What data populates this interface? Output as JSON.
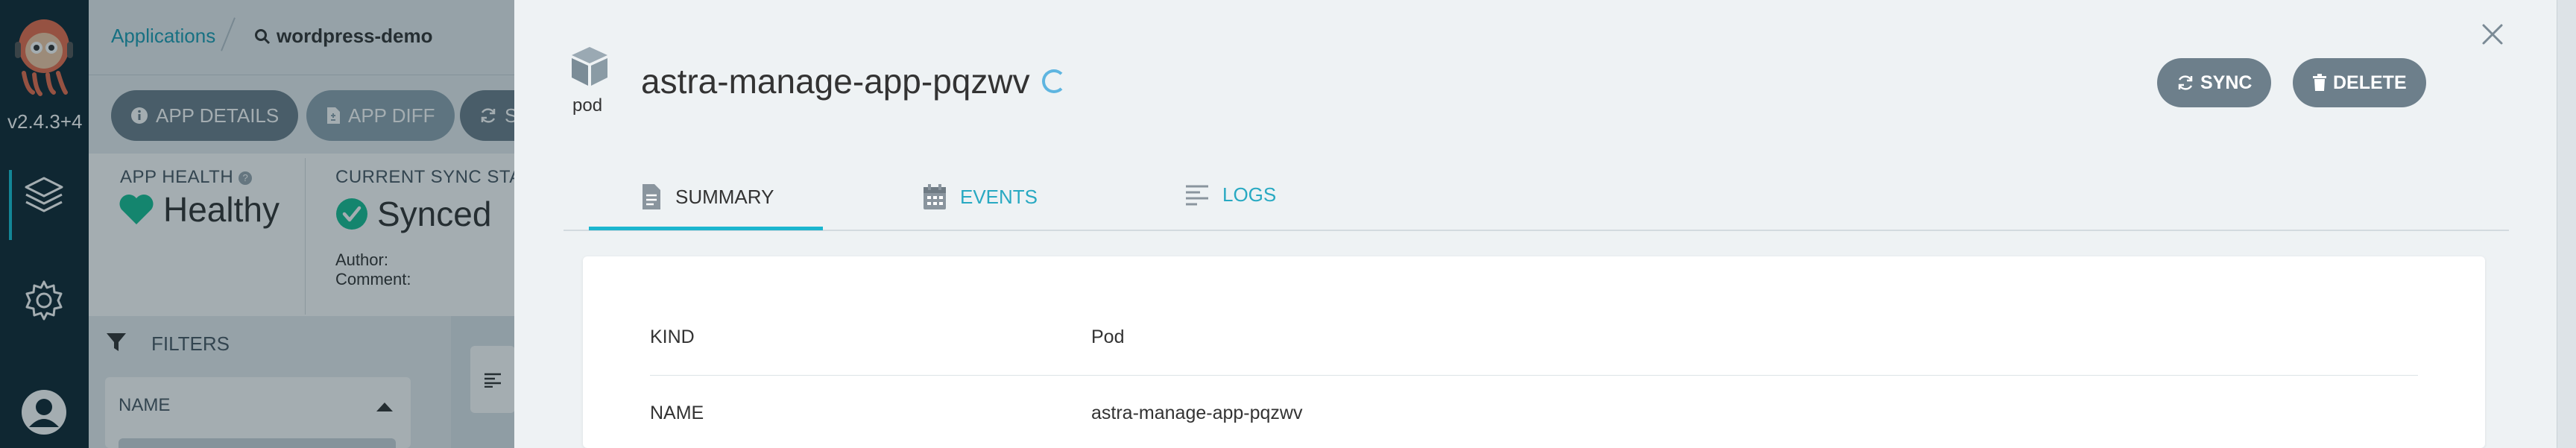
{
  "nav": {
    "version": "v2.4.3+4",
    "items": [
      {
        "icon": "applications-icon"
      },
      {
        "icon": "gear-icon"
      },
      {
        "icon": "user-icon"
      }
    ]
  },
  "breadcrumb": {
    "applications": "Applications",
    "current": "wordpress-demo"
  },
  "toolbar": {
    "app_details": "APP DETAILS",
    "app_diff": "APP DIFF",
    "sync_partial": "S"
  },
  "status": {
    "app_health_label": "APP HEALTH",
    "health_value": "Healthy",
    "current_sync_label": "CURRENT SYNC STAT",
    "sync_value": "Synced",
    "author_label": "Author:",
    "comment_label": "Comment:"
  },
  "filters": {
    "title": "FILTERS",
    "name_label": "NAME"
  },
  "panel": {
    "kind_icon_label": "pod",
    "resource_name": "astra-manage-app-pqzwv",
    "sync_button": "SYNC",
    "delete_button": "DELETE",
    "tabs": [
      {
        "label": "SUMMARY",
        "icon": "document-icon",
        "active": true
      },
      {
        "label": "EVENTS",
        "icon": "calendar-icon",
        "active": false
      },
      {
        "label": "LOGS",
        "icon": "logs-icon",
        "active": false
      }
    ],
    "summary": [
      {
        "key": "KIND",
        "value": "Pod"
      },
      {
        "key": "NAME",
        "value": "astra-manage-app-pqzwv"
      }
    ]
  },
  "colors": {
    "accent": "#1bb6cf",
    "link": "#28a9c2",
    "healthy": "#18be94",
    "nav_bg": "#0f2733",
    "button": "#6d7f8b"
  }
}
